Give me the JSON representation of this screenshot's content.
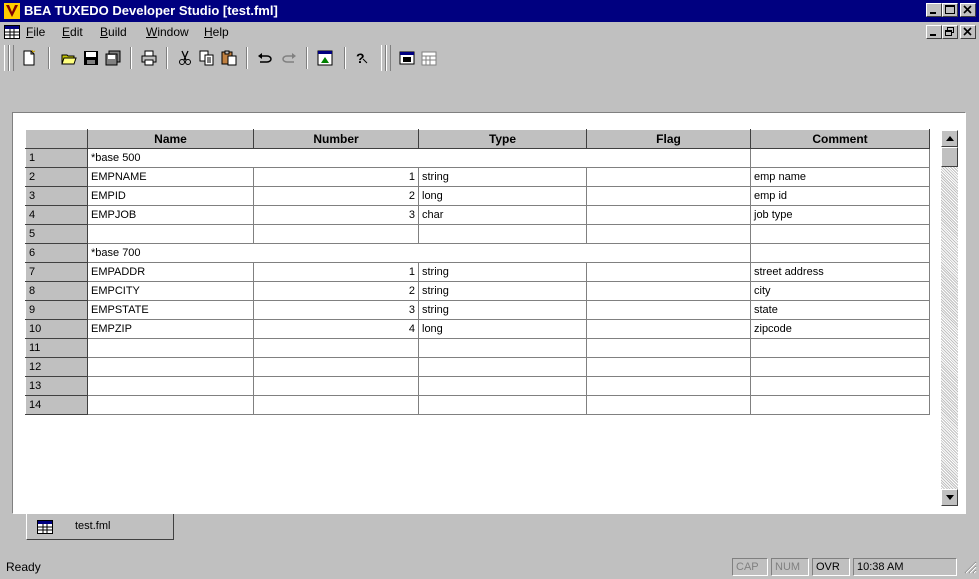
{
  "window": {
    "title": "BEA TUXEDO Developer Studio   [test.fml]",
    "icon": "bea-logo-icon",
    "caption_buttons": [
      "minimize",
      "maximize",
      "close"
    ]
  },
  "menu": {
    "items": [
      {
        "label": "File",
        "mnemonic": "F"
      },
      {
        "label": "Edit",
        "mnemonic": "E"
      },
      {
        "label": "Build",
        "mnemonic": "B"
      },
      {
        "label": "Window",
        "mnemonic": "W"
      },
      {
        "label": "Help",
        "mnemonic": "H"
      }
    ],
    "mdi_buttons": [
      "minimize",
      "restore",
      "close"
    ]
  },
  "toolbar": {
    "buttons": [
      "new-icon",
      "open-icon",
      "save-icon",
      "save-all-icon",
      "print-icon",
      "cut-icon",
      "copy-icon",
      "paste-icon",
      "undo-icon",
      "redo-icon",
      "properties-icon",
      "help-icon",
      "window-icon",
      "calendar-icon"
    ]
  },
  "grid": {
    "columns": [
      "Name",
      "Number",
      "Type",
      "Flag",
      "Comment"
    ],
    "rows": [
      {
        "row": "1",
        "name": "*base 500",
        "number": "",
        "type": "",
        "flag": "",
        "comment": "",
        "merged": true
      },
      {
        "row": "2",
        "name": "EMPNAME",
        "number": "1",
        "type": "string",
        "flag": "",
        "comment": "emp name"
      },
      {
        "row": "3",
        "name": "EMPID",
        "number": "2",
        "type": "long",
        "flag": "",
        "comment": "emp id"
      },
      {
        "row": "4",
        "name": "EMPJOB",
        "number": "3",
        "type": "char",
        "flag": "",
        "comment": "job type"
      },
      {
        "row": "5",
        "name": "",
        "number": "",
        "type": "",
        "flag": "",
        "comment": ""
      },
      {
        "row": "6",
        "name": "*base 700",
        "number": "",
        "type": "",
        "flag": "",
        "comment": "",
        "merged": true
      },
      {
        "row": "7",
        "name": "EMPADDR",
        "number": "1",
        "type": "string",
        "flag": "",
        "comment": "street address"
      },
      {
        "row": "8",
        "name": "EMPCITY",
        "number": "2",
        "type": "string",
        "flag": "",
        "comment": "city"
      },
      {
        "row": "9",
        "name": "EMPSTATE",
        "number": "3",
        "type": "string",
        "flag": "",
        "comment": "state"
      },
      {
        "row": "10",
        "name": "EMPZIP",
        "number": "4",
        "type": "long",
        "flag": "",
        "comment": "zipcode"
      },
      {
        "row": "11",
        "name": "",
        "number": "",
        "type": "",
        "flag": "",
        "comment": ""
      },
      {
        "row": "12",
        "name": "",
        "number": "",
        "type": "",
        "flag": "",
        "comment": ""
      },
      {
        "row": "13",
        "name": "",
        "number": "",
        "type": "",
        "flag": "",
        "comment": ""
      },
      {
        "row": "14",
        "name": "",
        "number": "",
        "type": "",
        "flag": "",
        "comment": ""
      }
    ]
  },
  "tabs": [
    {
      "label": "test.fml",
      "icon": "grid-doc-icon",
      "active": true
    }
  ],
  "status": {
    "text": "Ready",
    "indicators": [
      {
        "label": "CAP",
        "active": false
      },
      {
        "label": "NUM",
        "active": false
      },
      {
        "label": "OVR",
        "active": true
      },
      {
        "label": "10:38 AM",
        "active": true
      }
    ]
  },
  "colors": {
    "titlebar": "#000080",
    "chrome": "#c0c0c0",
    "workspace": "#ffffff"
  }
}
